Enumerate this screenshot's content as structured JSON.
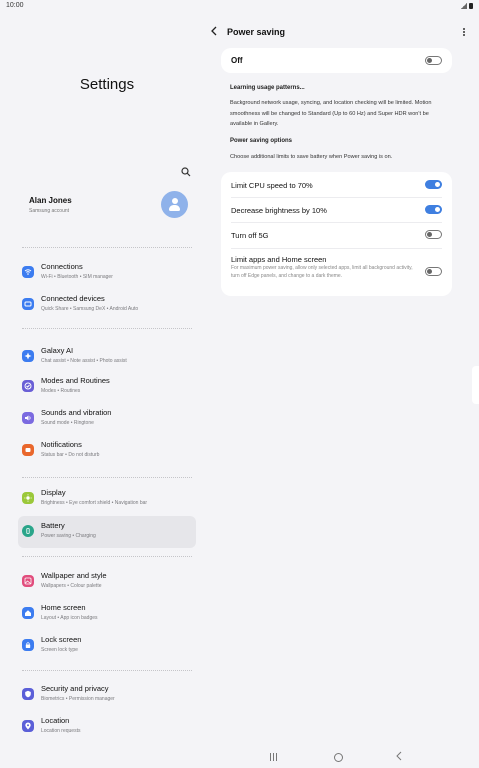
{
  "status_bar": {
    "time": "10:00"
  },
  "left": {
    "title": "Settings",
    "profile": {
      "name": "Alan Jones",
      "subtitle": "Samsung account"
    },
    "items": [
      {
        "id": "connections",
        "label": "Connections",
        "sub": "Wi-Fi • Bluetooth • SIM manager",
        "icon": "wifi-icon",
        "color": "#3c7cf0"
      },
      {
        "id": "connected-devices",
        "label": "Connected devices",
        "sub": "Quick Share • Samsung DeX • Android Auto",
        "icon": "devices-icon",
        "color": "#3c7cf0"
      },
      {
        "id": "galaxy-ai",
        "label": "Galaxy AI",
        "sub": "Chat assist • Note assist • Photo assist",
        "icon": "sparkle-icon",
        "color": "#3c7cf0"
      },
      {
        "id": "modes-routines",
        "label": "Modes and Routines",
        "sub": "Modes • Routines",
        "icon": "check-circle-icon",
        "color": "#6a5fd6"
      },
      {
        "id": "sounds",
        "label": "Sounds and vibration",
        "sub": "Sound mode • Ringtone",
        "icon": "speaker-icon",
        "color": "#7b6ae0"
      },
      {
        "id": "notifications",
        "label": "Notifications",
        "sub": "Status bar • Do not disturb",
        "icon": "bell-icon",
        "color": "#e9672c"
      },
      {
        "id": "display",
        "label": "Display",
        "sub": "Brightness • Eye comfort shield • Navigation bar",
        "icon": "sun-icon",
        "color": "#9bc83a"
      },
      {
        "id": "battery",
        "label": "Battery",
        "sub": "Power saving • Charging",
        "icon": "battery-icon",
        "color": "#2aa58a"
      },
      {
        "id": "wallpaper",
        "label": "Wallpaper and style",
        "sub": "Wallpapers • Colour palette",
        "icon": "image-icon",
        "color": "#e14d7d"
      },
      {
        "id": "home-screen",
        "label": "Home screen",
        "sub": "Layout • App icon badges",
        "icon": "home-icon",
        "color": "#3c7cf0"
      },
      {
        "id": "lock-screen",
        "label": "Lock screen",
        "sub": "Screen lock type",
        "icon": "lock-icon",
        "color": "#3c7cf0"
      },
      {
        "id": "security",
        "label": "Security and privacy",
        "sub": "Biometrics • Permission manager",
        "icon": "shield-icon",
        "color": "#5b5fd8"
      },
      {
        "id": "location",
        "label": "Location",
        "sub": "Location requests",
        "icon": "pin-icon",
        "color": "#5b5fd8"
      }
    ]
  },
  "right": {
    "title": "Power saving",
    "master": {
      "label": "Off",
      "enabled": false
    },
    "learning_title": "Learning usage patterns...",
    "learning_body": "Background network usage, syncing, and location checking will be limited. Motion smoothness will be changed to Standard (Up to 60 Hz) and Super HDR won't be available in Gallery.",
    "options_header": "Power saving options",
    "options_body": "Choose additional limits to save battery when Power saving is on.",
    "options": [
      {
        "label": "Limit CPU speed to 70%",
        "on": true
      },
      {
        "label": "Decrease brightness by 10%",
        "on": true
      },
      {
        "label": "Turn off 5G",
        "on": false
      },
      {
        "label": "Limit apps and Home screen",
        "desc": "For maximum power saving, allow only selected apps, limit all background activity, turn off Edge panels, and change to a dark theme.",
        "on": false
      }
    ]
  },
  "colors": {
    "accent": "#3f7fe0",
    "selected_bg": "#e6e6ea",
    "background": "#f4f4f7"
  }
}
